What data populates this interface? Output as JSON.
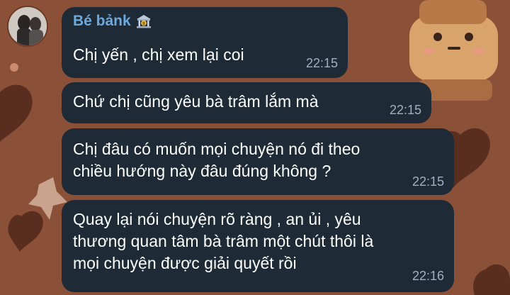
{
  "chat": {
    "sender_name": "Bé bảnk",
    "sender_badge_icon": "bank-icon",
    "messages": [
      {
        "text": "Chị yến , chị xem lại coi",
        "time": "22:15"
      },
      {
        "text": "Chứ chị cũng yêu bà trâm lắm mà",
        "time": "22:15"
      },
      {
        "text": "Chị đâu có muốn mọi chuyện nó đi theo\nchiều hướng này đâu đúng không ?",
        "time": "22:15"
      },
      {
        "text": "Quay lại nói chuyện rõ ràng , an ủi , yêu\nthương quan tâm bà trâm một chút thôi là\nmọi chuyện được giải quyết rồi",
        "time": "22:16"
      }
    ]
  },
  "colors": {
    "wallpaper": "#8a5038",
    "bubble": "#1e2a36",
    "sender_name": "#6ea9dd",
    "time": "#9fb0c0"
  }
}
